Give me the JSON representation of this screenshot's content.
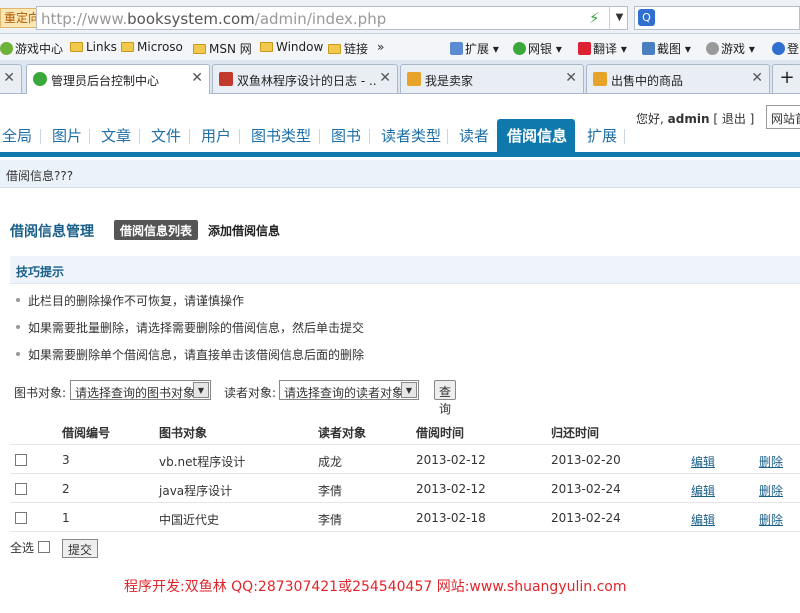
{
  "browser": {
    "redirect_label": "重定向",
    "url_prefix": "http://www.",
    "url_domain": "booksystem.com",
    "url_path": "/admin/index.php",
    "bookmarks": [
      "游戏中心",
      "Links",
      "Microso",
      "MSN 网",
      "Window",
      "链接",
      "»",
      "扩展",
      "网银",
      "翻译",
      "截图",
      "游戏",
      "登"
    ],
    "tabs": [
      {
        "label": "管理员后台控制中心",
        "active": true
      },
      {
        "label": "双鱼林程序设计的日志 - ...",
        "active": false
      },
      {
        "label": "我是卖家",
        "active": false
      },
      {
        "label": "出售中的商品",
        "active": false
      }
    ],
    "new_tab": "+"
  },
  "header": {
    "greeting": "您好,",
    "user": "admin",
    "logout": "[ 退出 ]",
    "site_link": "网站首页"
  },
  "nav": [
    "全局",
    "图片",
    "文章",
    "文件",
    "用户",
    "图书类型",
    "图书",
    "读者类型",
    "读者",
    "借阅信息",
    "扩展"
  ],
  "nav_active": "借阅信息",
  "breadcrumb": "借阅信息???",
  "page": {
    "title": "借阅信息管理",
    "tab_list": "借阅信息列表",
    "tab_add": "添加借阅信息"
  },
  "tips": {
    "heading": "技巧提示",
    "items": [
      "此栏目的删除操作不可恢复，请谨慎操作",
      "如果需要批量删除，请选择需要删除的借阅信息，然后单击提交",
      "如果需要删除单个借阅信息，请直接单击该借阅信息后面的删除"
    ]
  },
  "filter": {
    "book_label": "图书对象:",
    "book_value": "请选择查询的图书对象",
    "reader_label": "读者对象:",
    "reader_value": "请选择查询的读者对象",
    "query": "查询"
  },
  "table": {
    "columns": [
      "借阅编号",
      "图书对象",
      "读者对象",
      "借阅时间",
      "归还时间"
    ],
    "rows": [
      {
        "id": "3",
        "book": "vb.net程序设计",
        "reader": "成龙",
        "borrow": "2013-02-12",
        "return": "2013-02-20",
        "edit": "编辑",
        "delete": "删除"
      },
      {
        "id": "2",
        "book": "java程序设计",
        "reader": "李倩",
        "borrow": "2013-02-12",
        "return": "2013-02-24",
        "edit": "编辑",
        "delete": "删除"
      },
      {
        "id": "1",
        "book": "中国近代史",
        "reader": "李倩",
        "borrow": "2013-02-18",
        "return": "2013-02-24",
        "edit": "编辑",
        "delete": "删除"
      }
    ]
  },
  "select_all": "全选",
  "submit": "提交",
  "footer": "程序开发:双鱼林 QQ:287307421或254540457 网站:www.shuangyulin.com"
}
